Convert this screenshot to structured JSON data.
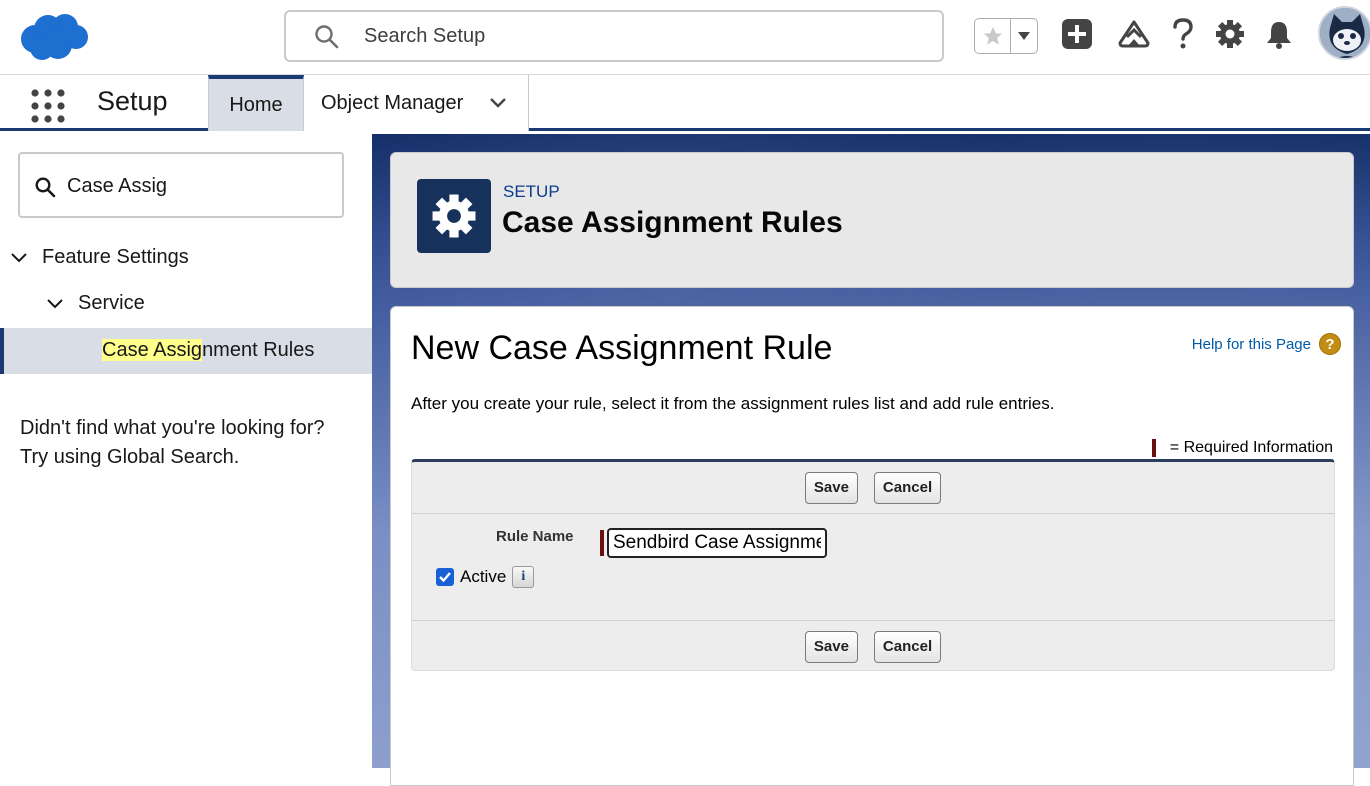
{
  "header": {
    "search_placeholder": "Search Setup",
    "icons": [
      "salesforce-cloud-logo",
      "search-icon",
      "star-icon",
      "dropdown-icon",
      "add-icon",
      "trailhead-icon",
      "help-icon",
      "gear-icon",
      "bell-icon",
      "avatar"
    ]
  },
  "nav": {
    "app_name": "Setup",
    "tabs": [
      {
        "label": "Home",
        "active": true
      },
      {
        "label": "Object Manager",
        "active": false
      }
    ]
  },
  "sidebar": {
    "quick_find_value": "Case Assig",
    "tree": {
      "feature_settings": "Feature Settings",
      "service": "Service",
      "selected_highlight": "Case Assig",
      "selected_rest": "nment Rules"
    },
    "no_find_line1": "Didn't find what you're looking for?",
    "no_find_line2": "Try using Global Search."
  },
  "page_header": {
    "breadcrumb": "SETUP",
    "title": "Case Assignment Rules"
  },
  "content": {
    "heading": "New Case Assignment Rule",
    "help_link": "Help for this Page",
    "help_glyph": "?",
    "intro": "After you create your rule, select it from the assignment rules list and add rule entries.",
    "required_info": "= Required Information",
    "form": {
      "save_label": "Save",
      "cancel_label": "Cancel",
      "rule_name_label": "Rule Name",
      "rule_name_value": "Sendbird Case Assignment",
      "active_label": "Active",
      "active_checked": true,
      "info_glyph": "i"
    }
  },
  "colors": {
    "brand_blue": "#1798c1",
    "nav_accent": "#1b3a74",
    "tile_bg": "#16325c",
    "required_bar": "#6b0e0e",
    "checkbox_blue": "#1960d6"
  }
}
